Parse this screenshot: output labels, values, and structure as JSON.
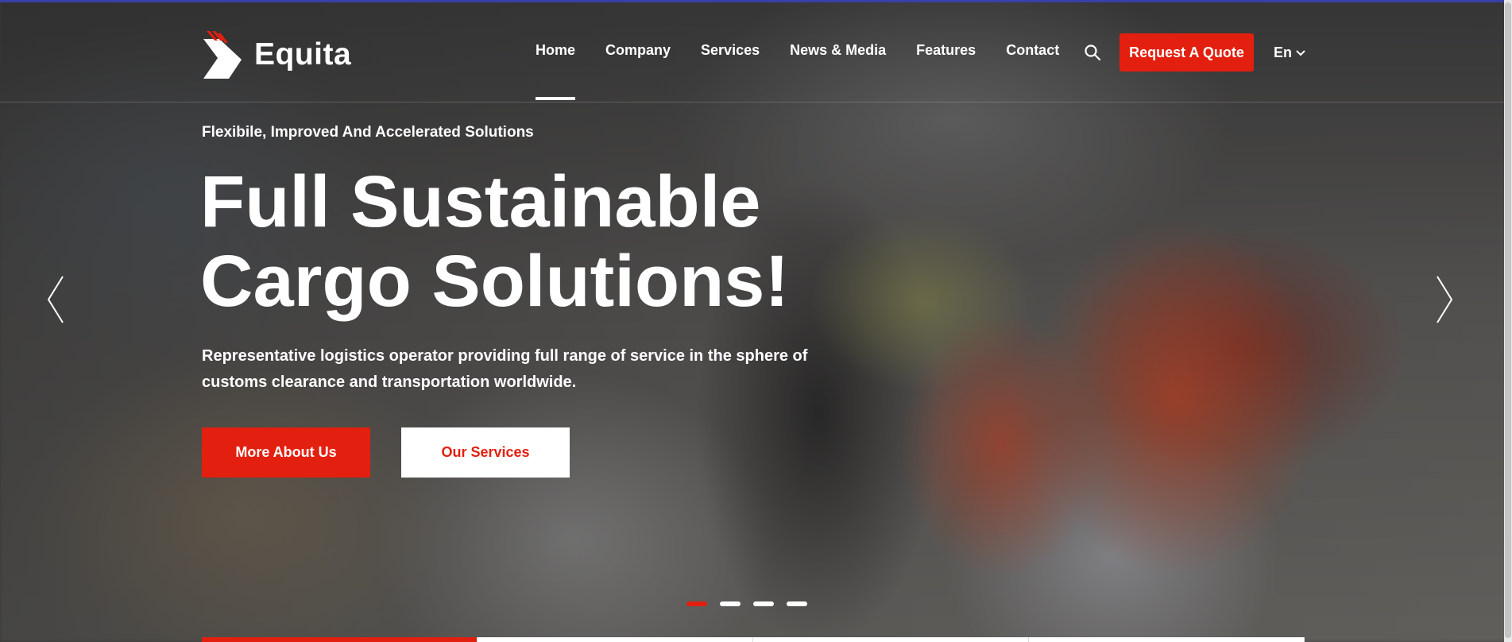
{
  "brand": {
    "name": "Equita",
    "accent_color": "#e3200f",
    "logo_icon": "chevron-logo-icon"
  },
  "nav": {
    "items": [
      {
        "label": "Home",
        "active": true
      },
      {
        "label": "Company",
        "active": false
      },
      {
        "label": "Services",
        "active": false
      },
      {
        "label": "News & Media",
        "active": false
      },
      {
        "label": "Features",
        "active": false
      },
      {
        "label": "Contact",
        "active": false
      }
    ],
    "search_icon": "search-icon",
    "quote_label": "Request A Quote",
    "language_label": "En",
    "language_icon": "chevron-down-icon"
  },
  "hero": {
    "eyebrow": "Flexibile, Improved And Accelerated Solutions",
    "headline_line1": "Full Sustainable",
    "headline_line2": "Cargo Solutions!",
    "lede_line1": "Representative logistics operator providing full range of service in the sphere of",
    "lede_line2": "customs clearance and transportation worldwide.",
    "primary_label": "More About Us",
    "secondary_label": "Our Services"
  },
  "slider": {
    "prev_icon": "chevron-left-icon",
    "next_icon": "chevron-right-icon",
    "slide_count": 4,
    "active_slide": 1
  }
}
